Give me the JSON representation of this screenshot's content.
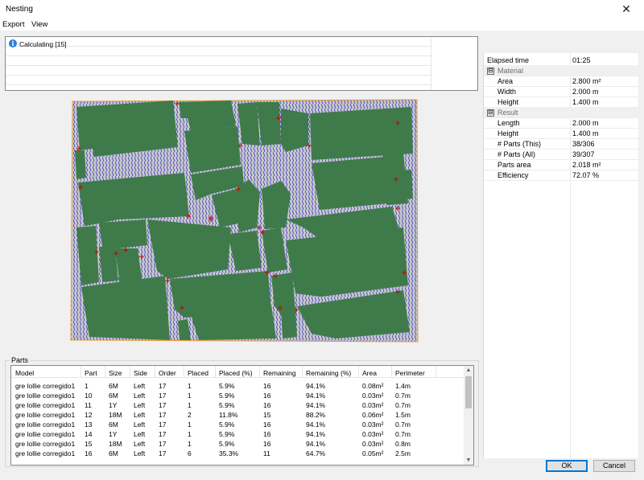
{
  "window": {
    "title": "Nesting",
    "close_glyph": "✕"
  },
  "menu": [
    {
      "label": "Export"
    },
    {
      "label": "View"
    }
  ],
  "log": {
    "message": "Calculating [15]",
    "icon": "info-icon"
  },
  "properties": {
    "elapsed": {
      "label": "Elapsed time",
      "value": "01:25"
    },
    "material": {
      "title": "Material",
      "toggle": "⊟",
      "rows": [
        {
          "label": "Area",
          "value": "2.800 m²"
        },
        {
          "label": "Width",
          "value": "2.000 m"
        },
        {
          "label": "Height",
          "value": "1.400 m"
        }
      ]
    },
    "result": {
      "title": "Result",
      "toggle": "⊟",
      "rows": [
        {
          "label": "Length",
          "value": "2.000 m"
        },
        {
          "label": "Height",
          "value": "1.400 m"
        },
        {
          "label": "# Parts (This)",
          "value": "38/306"
        },
        {
          "label": "# Parts (All)",
          "value": "39/307"
        },
        {
          "label": "Parts area",
          "value": "2.018 m²"
        },
        {
          "label": "Efficiency",
          "value": "72.07 %"
        }
      ]
    }
  },
  "nesting": {
    "sheet_color": "#c8c8c8",
    "part_color": "#3f7b4a",
    "border_color": "#e69a37",
    "marker_color": "#cc0000",
    "hatch_color": "#3434c8"
  },
  "parts": {
    "group_label": "Parts",
    "columns": [
      "Model",
      "Part",
      "Size",
      "Side",
      "Order",
      "Placed",
      "Placed (%)",
      "Remaining",
      "Remaining (%)",
      "Area",
      "Perimeter"
    ],
    "rows": [
      [
        "gre lollie corregido1",
        "1",
        "6M",
        "Left",
        "17",
        "1",
        "5.9%",
        "16",
        "94.1%",
        "0.08m²",
        "1.4m"
      ],
      [
        "gre lollie corregido1",
        "10",
        "6M",
        "Left",
        "17",
        "1",
        "5.9%",
        "16",
        "94.1%",
        "0.03m²",
        "0.7m"
      ],
      [
        "gre lollie corregido1",
        "11",
        "1Y",
        "Left",
        "17",
        "1",
        "5.9%",
        "16",
        "94.1%",
        "0.03m²",
        "0.7m"
      ],
      [
        "gre lollie corregido1",
        "12",
        "18M",
        "Left",
        "17",
        "2",
        "11.8%",
        "15",
        "88.2%",
        "0.06m²",
        "1.5m"
      ],
      [
        "gre lollie corregido1",
        "13",
        "6M",
        "Left",
        "17",
        "1",
        "5.9%",
        "16",
        "94.1%",
        "0.03m²",
        "0.7m"
      ],
      [
        "gre lollie corregido1",
        "14",
        "1Y",
        "Left",
        "17",
        "1",
        "5.9%",
        "16",
        "94.1%",
        "0.03m²",
        "0.7m"
      ],
      [
        "gre lollie corregido1",
        "15",
        "18M",
        "Left",
        "17",
        "1",
        "5.9%",
        "16",
        "94.1%",
        "0.03m²",
        "0.8m"
      ],
      [
        "gre lollie corregido1",
        "16",
        "6M",
        "Left",
        "17",
        "6",
        "35.3%",
        "11",
        "64.7%",
        "0.05m²",
        "2.5m"
      ]
    ]
  },
  "buttons": {
    "ok": "OK",
    "cancel": "Cancel"
  }
}
